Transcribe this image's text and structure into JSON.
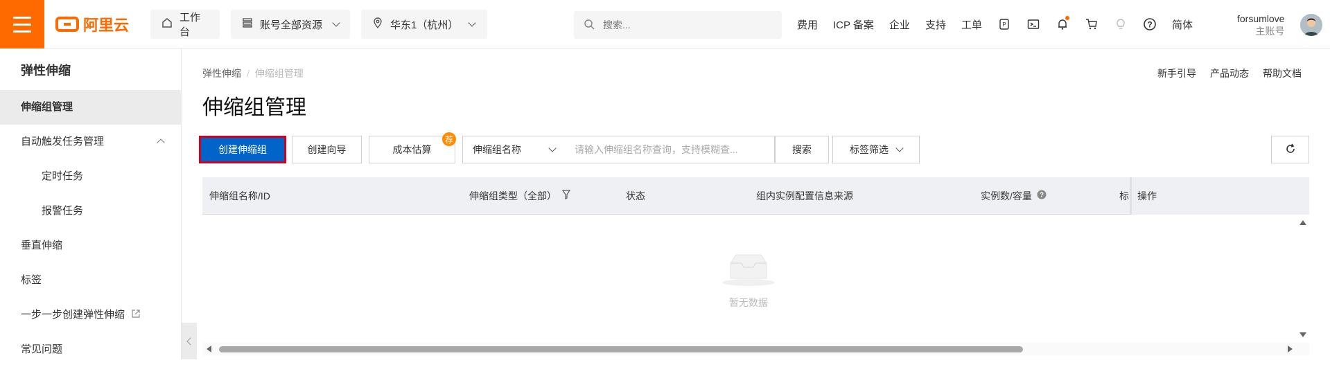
{
  "topbar": {
    "brand": "阿里云",
    "workbench": "工作台",
    "resources": "账号全部资源",
    "region": "华东1（杭州）",
    "search_placeholder": "搜索...",
    "links": [
      "费用",
      "ICP 备案",
      "企业",
      "支持",
      "工单"
    ],
    "lang": "简体",
    "user_name": "forsumlove",
    "user_role": "主账号",
    "accent_color": "#ff6a00"
  },
  "sidebar": {
    "title": "弹性伸缩",
    "items": [
      {
        "label": "伸缩组管理",
        "active": true
      },
      {
        "label": "自动触发任务管理"
      },
      {
        "label": "定时任务",
        "sub": true
      },
      {
        "label": "报警任务",
        "sub": true
      },
      {
        "label": "垂直伸缩"
      },
      {
        "label": "标签"
      },
      {
        "label": "一步一步创建弹性伸缩"
      },
      {
        "label": "常见问题"
      }
    ]
  },
  "main": {
    "breadcrumb": [
      "弹性伸缩",
      "伸缩组管理"
    ],
    "help_links": [
      "新手引导",
      "产品动态",
      "帮助文档"
    ],
    "title": "伸缩组管理",
    "buttons": {
      "create": "创建伸缩组",
      "wizard": "创建向导",
      "cost": "成本估算",
      "cost_badge": "荐",
      "search": "搜索",
      "tag_filter": "标签筛选"
    },
    "filter_select": "伸缩组名称",
    "query_placeholder": "请输入伸缩组名称查询，支持模糊查...",
    "table": {
      "columns": [
        "伸缩组名称/ID",
        "伸缩组类型（全部）",
        "状态",
        "组内实例配置信息来源",
        "实例数/容量",
        "标",
        "操作"
      ],
      "empty_text": "暂无数据"
    },
    "primary_color": "#0064c8"
  }
}
